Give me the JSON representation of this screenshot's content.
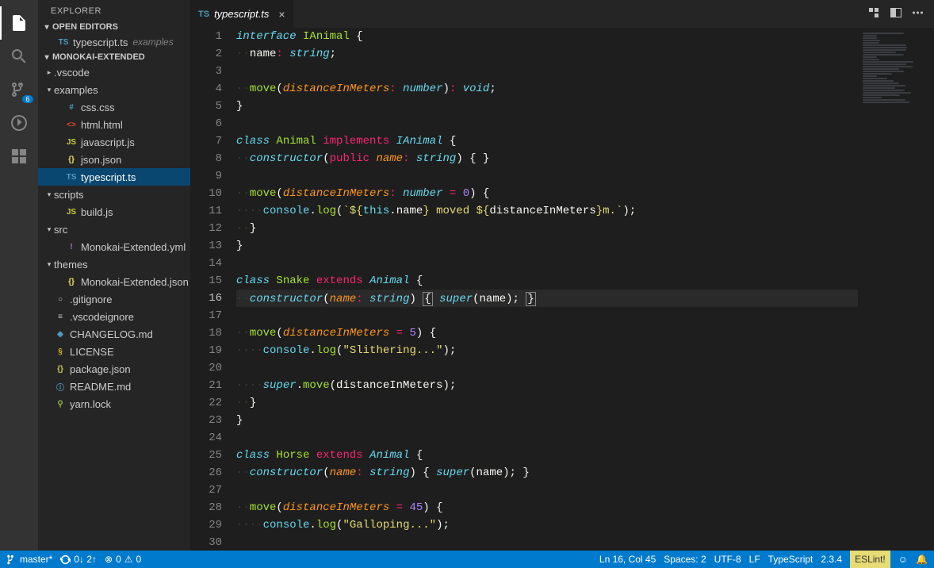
{
  "sidebar": {
    "title": "EXPLORER",
    "openEditorsHeader": "OPEN EDITORS",
    "openEditors": [
      {
        "icon": "TS",
        "iconClass": "c-ts",
        "label": "typescript.ts",
        "hint": "examples"
      }
    ],
    "folderHeader": "MONOKAI-EXTENDED",
    "tree": [
      {
        "depth": 0,
        "type": "folder",
        "open": false,
        "label": ".vscode"
      },
      {
        "depth": 0,
        "type": "folder",
        "open": true,
        "label": "examples"
      },
      {
        "depth": 1,
        "type": "file",
        "icon": "#",
        "iconClass": "c-css",
        "label": "css.css"
      },
      {
        "depth": 1,
        "type": "file",
        "icon": "<>",
        "iconClass": "c-html",
        "label": "html.html"
      },
      {
        "depth": 1,
        "type": "file",
        "icon": "JS",
        "iconClass": "c-js",
        "label": "javascript.js"
      },
      {
        "depth": 1,
        "type": "file",
        "icon": "{}",
        "iconClass": "c-json",
        "label": "json.json"
      },
      {
        "depth": 1,
        "type": "file",
        "icon": "TS",
        "iconClass": "c-ts",
        "label": "typescript.ts",
        "active": true
      },
      {
        "depth": 0,
        "type": "folder",
        "open": true,
        "label": "scripts"
      },
      {
        "depth": 1,
        "type": "file",
        "icon": "JS",
        "iconClass": "c-js",
        "label": "build.js"
      },
      {
        "depth": 0,
        "type": "folder",
        "open": true,
        "label": "src"
      },
      {
        "depth": 1,
        "type": "file",
        "icon": "!",
        "iconClass": "c-yml",
        "label": "Monokai-Extended.yml"
      },
      {
        "depth": 0,
        "type": "folder",
        "open": true,
        "label": "themes"
      },
      {
        "depth": 1,
        "type": "file",
        "icon": "{}",
        "iconClass": "c-json",
        "label": "Monokai-Extended.json"
      },
      {
        "depth": 0,
        "type": "file",
        "icon": "○",
        "iconClass": "c-git",
        "label": ".gitignore"
      },
      {
        "depth": 0,
        "type": "file",
        "icon": "≡",
        "iconClass": "c-git",
        "label": ".vscodeignore"
      },
      {
        "depth": 0,
        "type": "file",
        "icon": "◆",
        "iconClass": "c-md",
        "label": "CHANGELOG.md"
      },
      {
        "depth": 0,
        "type": "file",
        "icon": "§",
        "iconClass": "c-lic",
        "label": "LICENSE"
      },
      {
        "depth": 0,
        "type": "file",
        "icon": "{}",
        "iconClass": "c-pkg",
        "label": "package.json"
      },
      {
        "depth": 0,
        "type": "file",
        "icon": "ⓘ",
        "iconClass": "c-info",
        "label": "README.md"
      },
      {
        "depth": 0,
        "type": "file",
        "icon": "⚲",
        "iconClass": "c-lock",
        "label": "yarn.lock"
      }
    ]
  },
  "activity": {
    "scmBadge": "6"
  },
  "tab": {
    "icon": "TS",
    "label": "typescript.ts"
  },
  "editor": {
    "currentLine": 16,
    "lines": [
      [
        [
          "kw",
          "interface"
        ],
        [
          "plain",
          " "
        ],
        [
          "cls",
          "IAnimal"
        ],
        [
          "plain",
          " "
        ],
        [
          "punc",
          "{"
        ]
      ],
      [
        [
          "ws",
          "··"
        ],
        [
          "plain",
          "name"
        ],
        [
          "red",
          ":"
        ],
        [
          "plain",
          " "
        ],
        [
          "type",
          "string"
        ],
        [
          "punc",
          ";"
        ]
      ],
      [],
      [
        [
          "ws",
          "··"
        ],
        [
          "fn",
          "move"
        ],
        [
          "punc",
          "("
        ],
        [
          "param",
          "distanceInMeters"
        ],
        [
          "red",
          ":"
        ],
        [
          "plain",
          " "
        ],
        [
          "type",
          "number"
        ],
        [
          "punc",
          ")"
        ],
        [
          "red",
          ":"
        ],
        [
          "plain",
          " "
        ],
        [
          "type",
          "void"
        ],
        [
          "punc",
          ";"
        ]
      ],
      [
        [
          "punc",
          "}"
        ]
      ],
      [],
      [
        [
          "kw",
          "class"
        ],
        [
          "plain",
          " "
        ],
        [
          "cls",
          "Animal"
        ],
        [
          "plain",
          " "
        ],
        [
          "red",
          "implements"
        ],
        [
          "plain",
          " "
        ],
        [
          "type",
          "IAnimal"
        ],
        [
          "plain",
          " "
        ],
        [
          "punc",
          "{"
        ]
      ],
      [
        [
          "ws",
          "··"
        ],
        [
          "type",
          "constructor"
        ],
        [
          "punc",
          "("
        ],
        [
          "red",
          "public"
        ],
        [
          "plain",
          " "
        ],
        [
          "param",
          "name"
        ],
        [
          "red",
          ":"
        ],
        [
          "plain",
          " "
        ],
        [
          "type",
          "string"
        ],
        [
          "punc",
          ")"
        ],
        [
          "plain",
          " "
        ],
        [
          "punc",
          "{ }"
        ]
      ],
      [],
      [
        [
          "ws",
          "··"
        ],
        [
          "fn",
          "move"
        ],
        [
          "punc",
          "("
        ],
        [
          "param",
          "distanceInMeters"
        ],
        [
          "red",
          ":"
        ],
        [
          "plain",
          " "
        ],
        [
          "type",
          "number"
        ],
        [
          "plain",
          " "
        ],
        [
          "red",
          "="
        ],
        [
          "plain",
          " "
        ],
        [
          "num",
          "0"
        ],
        [
          "punc",
          ")"
        ],
        [
          "plain",
          " "
        ],
        [
          "punc",
          "{"
        ]
      ],
      [
        [
          "ws",
          "····"
        ],
        [
          "obj",
          "console"
        ],
        [
          "punc",
          "."
        ],
        [
          "fn",
          "log"
        ],
        [
          "punc",
          "("
        ],
        [
          "str",
          "`${"
        ],
        [
          "obj",
          "this"
        ],
        [
          "punc",
          "."
        ],
        [
          "plain",
          "name"
        ],
        [
          "str",
          "} moved ${"
        ],
        [
          "plain",
          "distanceInMeters"
        ],
        [
          "str",
          "}m.`"
        ],
        [
          "punc",
          ");"
        ]
      ],
      [
        [
          "ws",
          "··"
        ],
        [
          "punc",
          "}"
        ]
      ],
      [
        [
          "punc",
          "}"
        ]
      ],
      [],
      [
        [
          "kw",
          "class"
        ],
        [
          "plain",
          " "
        ],
        [
          "cls",
          "Snake"
        ],
        [
          "plain",
          " "
        ],
        [
          "red",
          "extends"
        ],
        [
          "plain",
          " "
        ],
        [
          "type",
          "Animal"
        ],
        [
          "plain",
          " "
        ],
        [
          "punc",
          "{"
        ]
      ],
      [
        [
          "ws",
          "··"
        ],
        [
          "type",
          "constructor"
        ],
        [
          "punc",
          "("
        ],
        [
          "param",
          "name"
        ],
        [
          "red",
          ":"
        ],
        [
          "plain",
          " "
        ],
        [
          "type",
          "string"
        ],
        [
          "punc",
          ")"
        ],
        [
          "plain",
          " "
        ],
        [
          "cursor",
          "{"
        ],
        [
          "plain",
          " "
        ],
        [
          "kw",
          "super"
        ],
        [
          "punc",
          "("
        ],
        [
          "plain",
          "name"
        ],
        [
          "punc",
          ");"
        ],
        [
          "plain",
          " "
        ],
        [
          "cursor",
          "}"
        ]
      ],
      [],
      [
        [
          "ws",
          "··"
        ],
        [
          "fn",
          "move"
        ],
        [
          "punc",
          "("
        ],
        [
          "param",
          "distanceInMeters"
        ],
        [
          "plain",
          " "
        ],
        [
          "red",
          "="
        ],
        [
          "plain",
          " "
        ],
        [
          "num",
          "5"
        ],
        [
          "punc",
          ")"
        ],
        [
          "plain",
          " "
        ],
        [
          "punc",
          "{"
        ]
      ],
      [
        [
          "ws",
          "····"
        ],
        [
          "obj",
          "console"
        ],
        [
          "punc",
          "."
        ],
        [
          "fn",
          "log"
        ],
        [
          "punc",
          "("
        ],
        [
          "str",
          "\"Slithering...\""
        ],
        [
          "punc",
          ");"
        ]
      ],
      [],
      [
        [
          "ws",
          "····"
        ],
        [
          "kw",
          "super"
        ],
        [
          "punc",
          "."
        ],
        [
          "fn",
          "move"
        ],
        [
          "punc",
          "("
        ],
        [
          "plain",
          "distanceInMeters"
        ],
        [
          "punc",
          ");"
        ]
      ],
      [
        [
          "ws",
          "··"
        ],
        [
          "punc",
          "}"
        ]
      ],
      [
        [
          "punc",
          "}"
        ]
      ],
      [],
      [
        [
          "kw",
          "class"
        ],
        [
          "plain",
          " "
        ],
        [
          "cls",
          "Horse"
        ],
        [
          "plain",
          " "
        ],
        [
          "red",
          "extends"
        ],
        [
          "plain",
          " "
        ],
        [
          "type",
          "Animal"
        ],
        [
          "plain",
          " "
        ],
        [
          "punc",
          "{"
        ]
      ],
      [
        [
          "ws",
          "··"
        ],
        [
          "type",
          "constructor"
        ],
        [
          "punc",
          "("
        ],
        [
          "param",
          "name"
        ],
        [
          "red",
          ":"
        ],
        [
          "plain",
          " "
        ],
        [
          "type",
          "string"
        ],
        [
          "punc",
          ")"
        ],
        [
          "plain",
          " "
        ],
        [
          "punc",
          "{"
        ],
        [
          "plain",
          " "
        ],
        [
          "kw",
          "super"
        ],
        [
          "punc",
          "("
        ],
        [
          "plain",
          "name"
        ],
        [
          "punc",
          ");"
        ],
        [
          "plain",
          " "
        ],
        [
          "punc",
          "}"
        ]
      ],
      [],
      [
        [
          "ws",
          "··"
        ],
        [
          "fn",
          "move"
        ],
        [
          "punc",
          "("
        ],
        [
          "param",
          "distanceInMeters"
        ],
        [
          "plain",
          " "
        ],
        [
          "red",
          "="
        ],
        [
          "plain",
          " "
        ],
        [
          "num",
          "45"
        ],
        [
          "punc",
          ")"
        ],
        [
          "plain",
          " "
        ],
        [
          "punc",
          "{"
        ]
      ],
      [
        [
          "ws",
          "····"
        ],
        [
          "obj",
          "console"
        ],
        [
          "punc",
          "."
        ],
        [
          "fn",
          "log"
        ],
        [
          "punc",
          "("
        ],
        [
          "str",
          "\"Galloping...\""
        ],
        [
          "punc",
          ");"
        ]
      ],
      []
    ]
  },
  "status": {
    "branch": "master*",
    "sync": "0↓ 2↑",
    "problems": "0  0",
    "errIcon": "⊗",
    "warnIcon": "⚠",
    "lnCol": "Ln 16, Col 45",
    "spaces": "Spaces: 2",
    "encoding": "UTF-8",
    "eol": "LF",
    "lang": "TypeScript",
    "version": "2.3.4",
    "eslint": "ESLint!",
    "feedback": "☺",
    "bell": "🔔"
  }
}
